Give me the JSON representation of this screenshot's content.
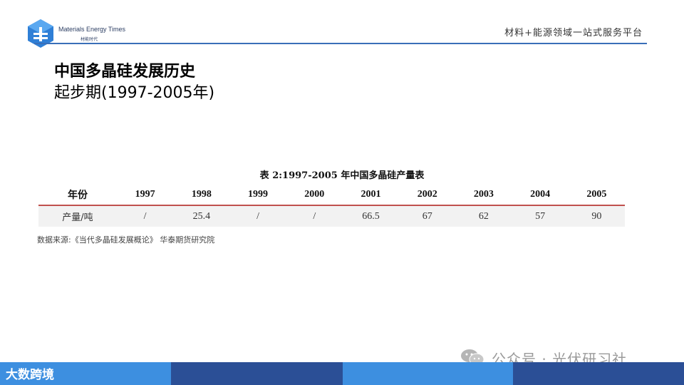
{
  "header": {
    "brand_en": "Materials Energy Times",
    "brand_cn": "材能时代",
    "tagline": "材料+能源领域一站式服务平台"
  },
  "titles": {
    "main": "中国多晶硅发展历史",
    "sub": "起步期(1997-2005年)"
  },
  "table": {
    "caption": "表 2:1997-2005 年中国多晶硅产量表",
    "header_label": "年份",
    "years": [
      "1997",
      "1998",
      "1999",
      "2000",
      "2001",
      "2002",
      "2003",
      "2004",
      "2005"
    ],
    "row_label": "产量/吨",
    "values": [
      "/",
      "25.4",
      "/",
      "/",
      "66.5",
      "67",
      "62",
      "57",
      "90"
    ]
  },
  "source": "数据来源:《当代多晶硅发展概论》 华泰期货研究院",
  "watermark": {
    "text": "公众号 · 光伏研习社"
  },
  "footer": {
    "brand": "大数跨境"
  },
  "colors": {
    "accent_blue": "#3a6fb8",
    "table_rule": "#c0504d",
    "footer_light": "#3d8fe0",
    "footer_dark": "#2b4f96"
  }
}
